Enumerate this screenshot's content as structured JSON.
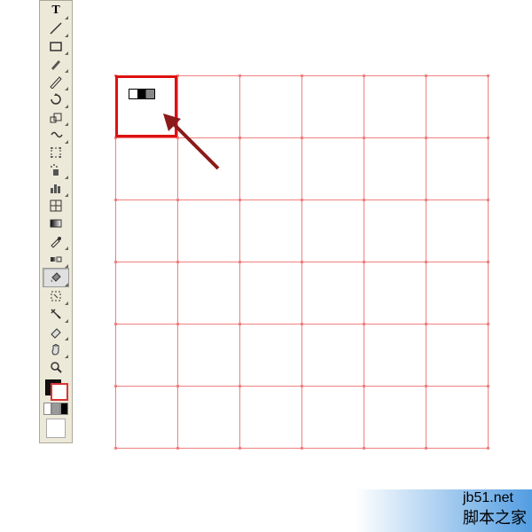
{
  "toolbox": {
    "tools": [
      {
        "name": "type-tool",
        "icon": "T",
        "submenu": true
      },
      {
        "name": "line-segment-tool",
        "icon": "line",
        "submenu": true
      },
      {
        "name": "rectangle-tool",
        "icon": "rect",
        "submenu": true
      },
      {
        "name": "paintbrush-tool",
        "icon": "brush",
        "submenu": true
      },
      {
        "name": "pencil-tool",
        "icon": "pencil",
        "submenu": true
      },
      {
        "name": "rotate-tool",
        "icon": "rotate",
        "submenu": true
      },
      {
        "name": "scale-tool",
        "icon": "scale",
        "submenu": true
      },
      {
        "name": "warp-tool",
        "icon": "warp",
        "submenu": true
      },
      {
        "name": "free-transform-tool",
        "icon": "freetrans",
        "submenu": false
      },
      {
        "name": "symbol-sprayer-tool",
        "icon": "spray",
        "submenu": true
      },
      {
        "name": "column-graph-tool",
        "icon": "graph",
        "submenu": true
      },
      {
        "name": "mesh-tool",
        "icon": "mesh",
        "submenu": false
      },
      {
        "name": "gradient-tool",
        "icon": "gradient",
        "submenu": false
      },
      {
        "name": "eyedropper-tool",
        "icon": "eyedrop",
        "submenu": true
      },
      {
        "name": "blend-tool",
        "icon": "blend",
        "submenu": true
      },
      {
        "name": "live-paint-bucket-tool",
        "icon": "livepaint",
        "submenu": true,
        "selected": true
      },
      {
        "name": "live-paint-selection-tool",
        "icon": "livesel",
        "submenu": true
      },
      {
        "name": "slice-tool",
        "icon": "slice",
        "submenu": true
      },
      {
        "name": "eraser-tool",
        "icon": "eraser",
        "submenu": true
      },
      {
        "name": "hand-tool",
        "icon": "hand",
        "submenu": true
      },
      {
        "name": "zoom-tool",
        "icon": "zoom",
        "submenu": false
      }
    ],
    "fill_color": "#111111",
    "stroke_color": "#dd3333",
    "swatches": [
      "#ffffff",
      "#999999",
      "#000000"
    ]
  },
  "grid": {
    "rows": 6,
    "cols": 6,
    "cell_size_px": 70,
    "line_color": "#f08080",
    "highlighted_cell": {
      "row": 0,
      "col": 0
    },
    "highlight_border_color": "#d11",
    "cell_gradient_swatch": [
      "#ffffff",
      "#000000",
      "#888888"
    ]
  },
  "annotation": {
    "arrow_color": "#8b1a1a"
  },
  "watermark": {
    "line1": "jb51.net",
    "line2": "脚本之家"
  }
}
